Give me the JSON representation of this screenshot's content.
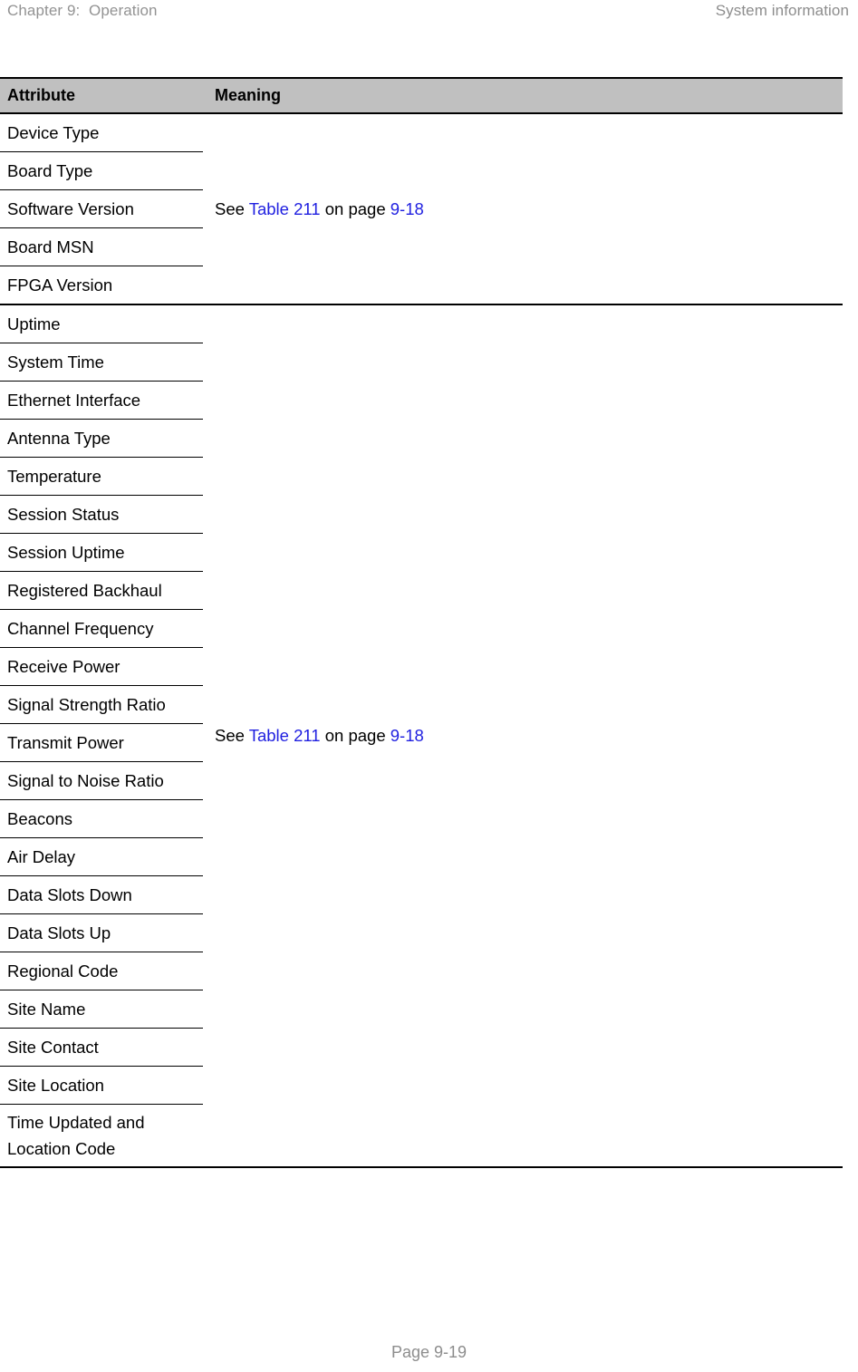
{
  "header": {
    "left": "Chapter 9:  Operation",
    "right": "System information"
  },
  "table": {
    "columns": {
      "attribute": "Attribute",
      "meaning": "Meaning"
    },
    "groups": [
      {
        "rows": [
          "Device Type",
          "Board Type",
          "Software Version",
          "Board MSN",
          "FPGA Version"
        ],
        "meaning": {
          "prefix": "See ",
          "link1": "Table 211",
          "middle": " on page ",
          "link2": "9-18"
        }
      },
      {
        "rows": [
          "Uptime",
          "System Time",
          "Ethernet Interface",
          "Antenna Type",
          "Temperature",
          "Session Status",
          "Session Uptime",
          "Registered Backhaul",
          "Channel Frequency",
          "Receive Power",
          "Signal Strength Ratio",
          "Transmit Power",
          "Signal to Noise Ratio",
          "Beacons",
          "Air Delay",
          "Data Slots Down",
          "Data Slots Up",
          "Regional Code",
          "Site Name",
          "Site Contact",
          "Site Location",
          "Time Updated and Location Code"
        ],
        "meaning": {
          "prefix": "See ",
          "link1": "Table 211",
          "middle": " on page ",
          "link2": "9-18"
        }
      }
    ]
  },
  "footer": {
    "page": "Page 9-19"
  },
  "colors": {
    "header_band": "#c0c0c0",
    "link": "#1f1fe0",
    "running_header": "#8d8d8d"
  }
}
